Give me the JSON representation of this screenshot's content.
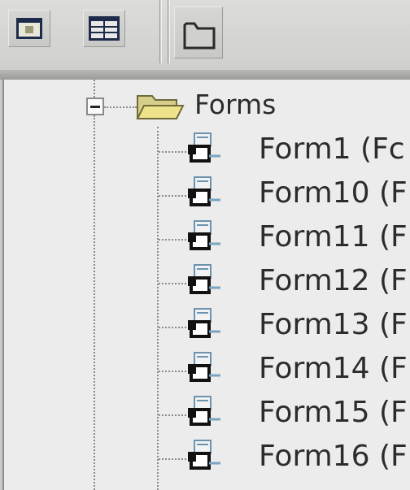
{
  "toolbar": {
    "buttons": [
      {
        "name": "view-single-button",
        "icon": "window-icon"
      },
      {
        "name": "view-split-button",
        "icon": "split-window-icon"
      },
      {
        "name": "open-folder-button",
        "icon": "folder-icon"
      }
    ]
  },
  "tree": {
    "folder": {
      "label": "Forms",
      "icon": "open-folder-icon",
      "expanded": true
    },
    "items": [
      {
        "label": "Form1 (Fc"
      },
      {
        "label": "Form10 (F"
      },
      {
        "label": "Form11 (F"
      },
      {
        "label": "Form12 (F"
      },
      {
        "label": "Form13 (F"
      },
      {
        "label": "Form14 (F"
      },
      {
        "label": "Form15 (F"
      },
      {
        "label": "Form16 (F"
      }
    ]
  },
  "colors": {
    "background": "#c9c9c7",
    "tree_background": "#ececec",
    "text": "#2c2c2c"
  }
}
